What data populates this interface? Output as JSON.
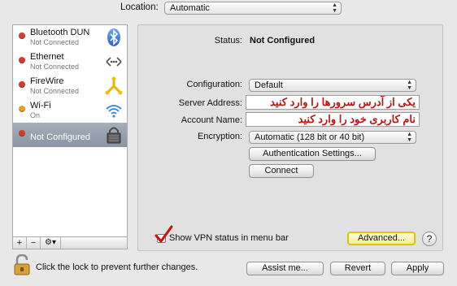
{
  "location": {
    "label": "Location:",
    "value": "Automatic"
  },
  "services": [
    {
      "name": "Bluetooth DUN",
      "status": "Not Connected",
      "dot_color": "#d83b2f",
      "icon": "bluetooth-icon"
    },
    {
      "name": "Ethernet",
      "status": "Not Connected",
      "dot_color": "#d83b2f",
      "icon": "ethernet-icon"
    },
    {
      "name": "FireWire",
      "status": "Not Connected",
      "dot_color": "#d83b2f",
      "icon": "firewire-icon"
    },
    {
      "name": "Wi-Fi",
      "status": "On",
      "dot_color": "#e9a21f",
      "icon": "wifi-icon"
    },
    {
      "name": "Not Configured",
      "status": "",
      "dot_color": "#d83b2f",
      "icon": "vpn-lock-icon",
      "selected": true
    }
  ],
  "list_toolbar": {
    "add": "+",
    "remove": "−",
    "action": "⚙▾"
  },
  "detail": {
    "status_label": "Status:",
    "status_value": "Not Configured",
    "configuration_label": "Configuration:",
    "configuration_value": "Default",
    "server_label": "Server Address:",
    "server_value": "یکی از آدرس سرورها را وارد کنید",
    "account_label": "Account Name:",
    "account_value": "نام کاربری خود را وارد کنید",
    "encryption_label": "Encryption:",
    "encryption_value": "Automatic (128 bit or 40 bit)",
    "auth_button": "Authentication Settings...",
    "connect_button": "Connect",
    "show_vpn_label": "Show VPN status in menu bar",
    "show_vpn_checked": true,
    "advanced_button": "Advanced...",
    "help_button": "?"
  },
  "bottom": {
    "lock_text": "Click the lock to prevent further changes.",
    "assist_button": "Assist me...",
    "revert_button": "Revert",
    "apply_button": "Apply"
  },
  "colors": {
    "annotation_red": "#cc1111",
    "advanced_highlight": "#f0d500",
    "selection": "#8e99a6"
  }
}
